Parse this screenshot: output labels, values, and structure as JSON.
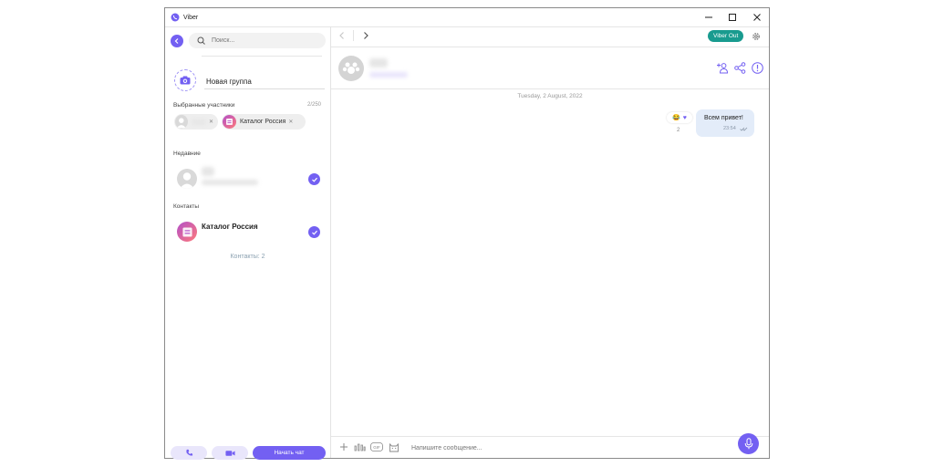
{
  "window": {
    "title": "Viber",
    "controls": {
      "minimize": "—",
      "maximize": "☐",
      "close": "✕"
    }
  },
  "left": {
    "search_placeholder": "Поиск...",
    "group_name": "Новая группа",
    "selected_label": "Выбранные участники",
    "selected_count": "2/250",
    "chips": [
      {
        "label": ""
      },
      {
        "label": "Каталог Россия"
      }
    ],
    "recent_label": "Недавние",
    "contacts_label": "Контакты",
    "contact_name": "Каталог Россия",
    "contacts_count": "Контакты: 2",
    "start_chat": "Начать чат"
  },
  "right": {
    "viber_out": "Viber Out",
    "date": "Tuesday, 2 August, 2022",
    "message": {
      "text": "Всем привет!",
      "time": "23:54"
    },
    "reactions": {
      "emoji": "😂",
      "heart": "♥",
      "count": "2"
    },
    "composer_placeholder": "Напишите сообщение..."
  },
  "colors": {
    "accent": "#7360f2",
    "viber_out": "#199b8f",
    "bubble": "#e3ecf9"
  },
  "icons": [
    "viber-logo-icon",
    "back-arrow-icon",
    "search-icon",
    "camera-icon",
    "close-icon",
    "check-icon",
    "phone-icon",
    "video-icon",
    "chevron-left-icon",
    "chevron-right-icon",
    "gear-icon",
    "add-participant-icon",
    "share-icon",
    "info-icon",
    "plus-icon",
    "audio-icon",
    "gif-icon",
    "sticker-icon",
    "microphone-icon"
  ]
}
